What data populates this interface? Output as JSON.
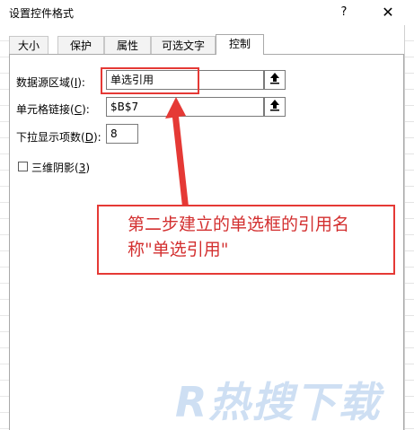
{
  "window": {
    "title": "设置控件格式",
    "help_label": "?",
    "close_label": "✕"
  },
  "tabs": [
    {
      "label": "大小"
    },
    {
      "label": "保护"
    },
    {
      "label": "属性"
    },
    {
      "label": "可选文字"
    },
    {
      "label": "控制",
      "active": true
    }
  ],
  "fields": {
    "input_range": {
      "label_pre": "数据源区域(",
      "label_key": "I",
      "label_post": "):",
      "value": "单选引用"
    },
    "cell_link": {
      "label_pre": "单元格链接(",
      "label_key": "C",
      "label_post": "):",
      "value": "$B$7"
    },
    "dropdown_lines": {
      "label_pre": "下拉显示项数(",
      "label_key": "D",
      "label_post": "):",
      "value": "8"
    }
  },
  "checkbox_3d": {
    "label_pre": "三维阴影(",
    "label_key": "3",
    "label_post": ")",
    "checked": false
  },
  "annotation": {
    "text": "第二步建立的单选框的引用名称\"单选引用\"",
    "color": "#e53935"
  },
  "watermark": {
    "text": "R热搜下载"
  },
  "icons": {
    "collapse": "collapse-dialog-icon"
  }
}
